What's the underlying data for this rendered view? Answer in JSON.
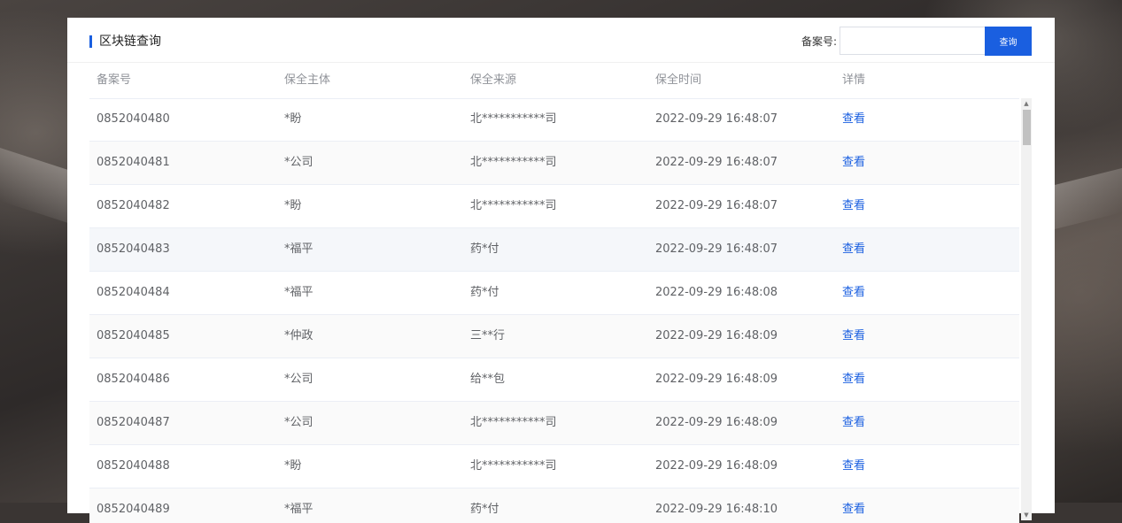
{
  "panel": {
    "title": "区块链查询",
    "search": {
      "label": "备案号:",
      "value": "",
      "placeholder": "",
      "button_label": "查询"
    }
  },
  "table": {
    "columns": [
      "备案号",
      "保全主体",
      "保全来源",
      "保全时间",
      "详情"
    ],
    "rows": [
      {
        "id": "0852040480",
        "subject": "*盼",
        "source": "北***********司",
        "time": "2022-09-29 16:48:07",
        "detail": "查看"
      },
      {
        "id": "0852040481",
        "subject": "*公司",
        "source": "北***********司",
        "time": "2022-09-29 16:48:07",
        "detail": "查看"
      },
      {
        "id": "0852040482",
        "subject": "*盼",
        "source": "北***********司",
        "time": "2022-09-29 16:48:07",
        "detail": "查看"
      },
      {
        "id": "0852040483",
        "subject": "*福平",
        "source": "药*付",
        "time": "2022-09-29 16:48:07",
        "detail": "查看"
      },
      {
        "id": "0852040484",
        "subject": "*福平",
        "source": "药*付",
        "time": "2022-09-29 16:48:08",
        "detail": "查看"
      },
      {
        "id": "0852040485",
        "subject": "*仲政",
        "source": "三**行",
        "time": "2022-09-29 16:48:09",
        "detail": "查看"
      },
      {
        "id": "0852040486",
        "subject": "*公司",
        "source": "给**包",
        "time": "2022-09-29 16:48:09",
        "detail": "查看"
      },
      {
        "id": "0852040487",
        "subject": "*公司",
        "source": "北***********司",
        "time": "2022-09-29 16:48:09",
        "detail": "查看"
      },
      {
        "id": "0852040488",
        "subject": "*盼",
        "source": "北***********司",
        "time": "2022-09-29 16:48:09",
        "detail": "查看"
      },
      {
        "id": "0852040489",
        "subject": "*福平",
        "source": "药*付",
        "time": "2022-09-29 16:48:10",
        "detail": "查看"
      }
    ]
  },
  "icons": {
    "scroll_up": "triangle-up-icon",
    "scroll_down": "triangle-down-icon",
    "title_marker": "bar-marker"
  },
  "colors": {
    "accent": "#1a5fe0",
    "header_text": "#909399",
    "cell_text": "#606266",
    "row_stripe": "#fafafa",
    "row_hover": "#f5f7fa"
  }
}
